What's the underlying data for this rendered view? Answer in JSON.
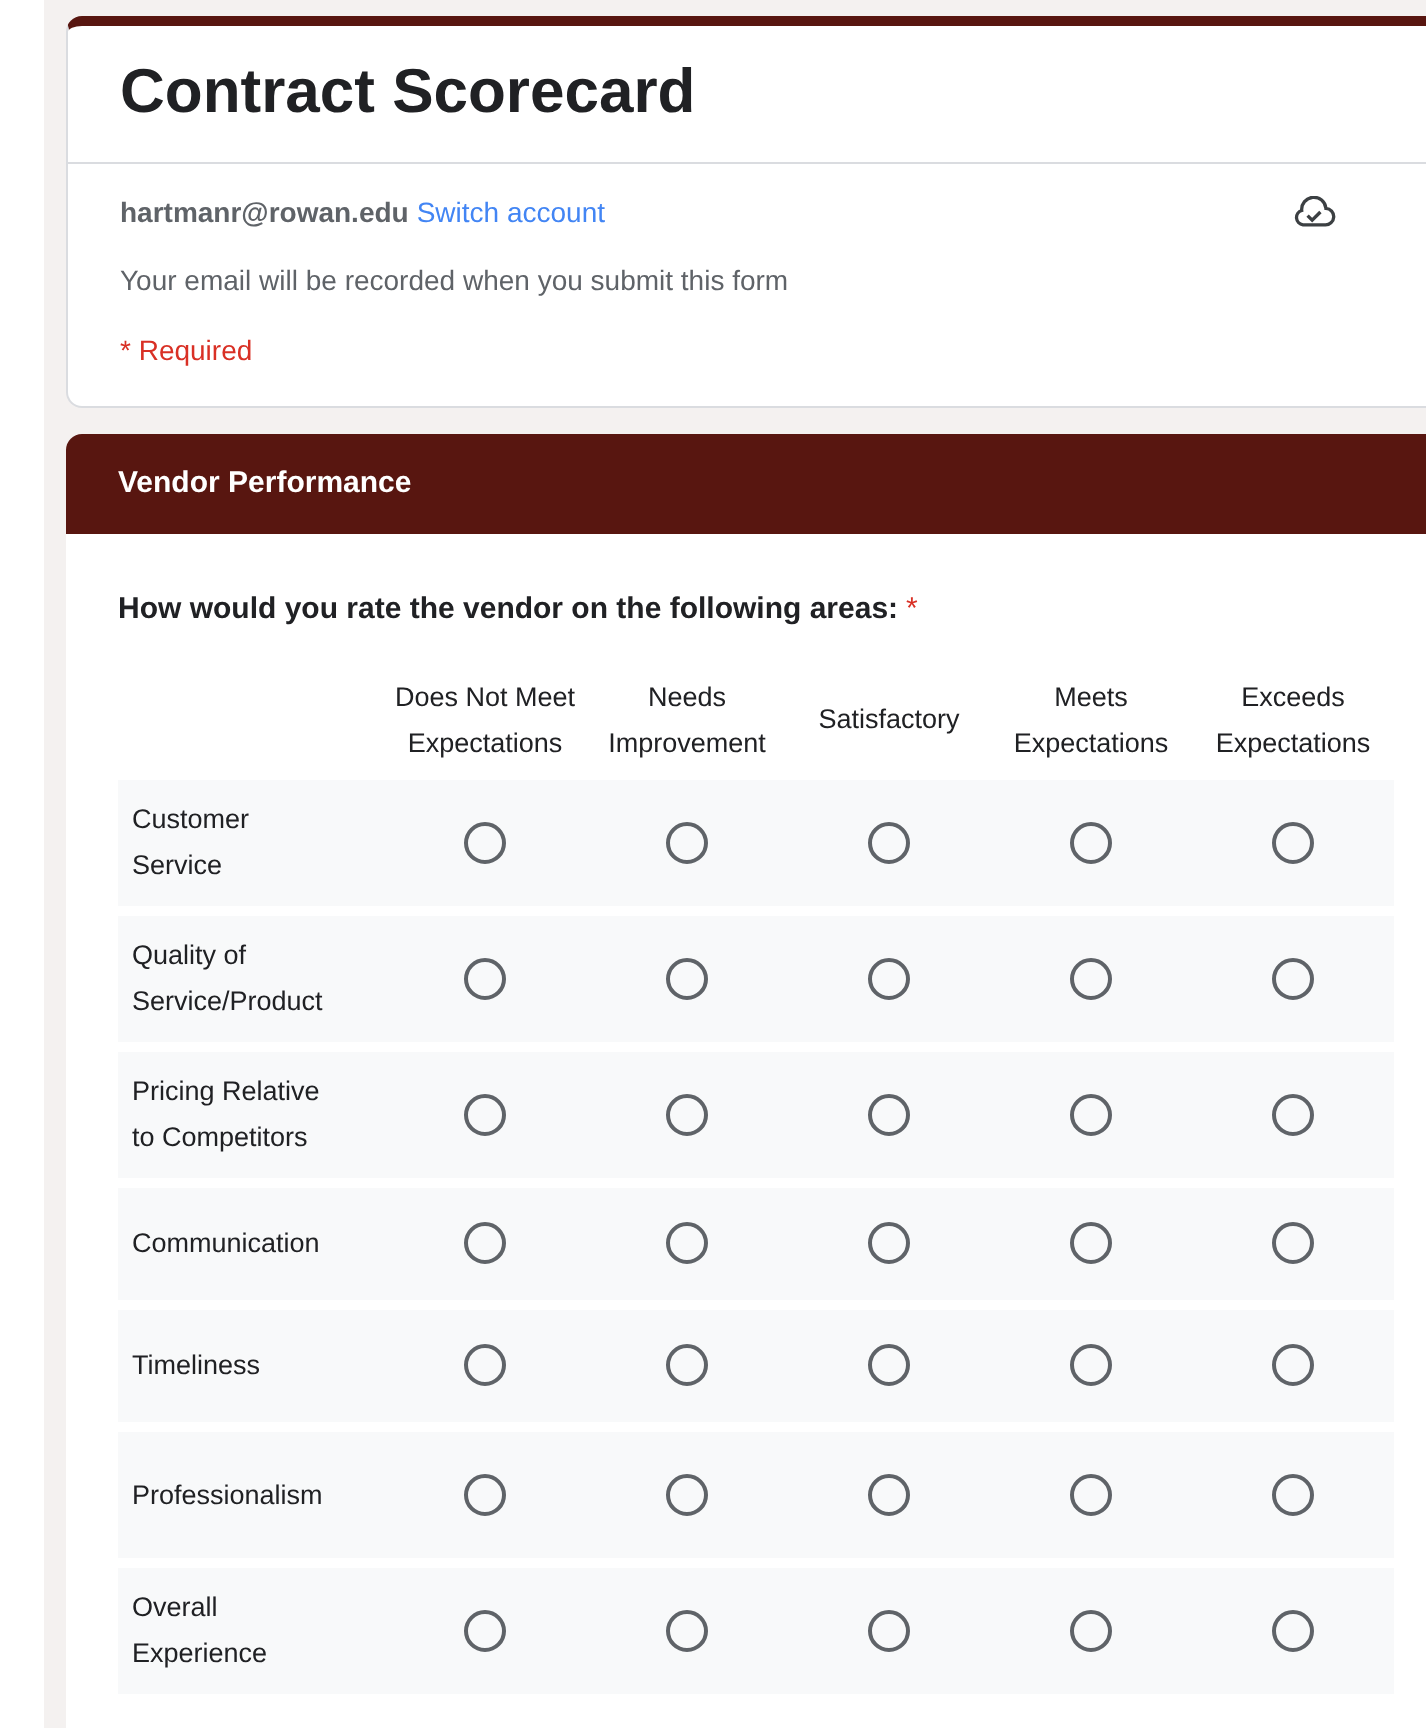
{
  "form": {
    "title": "Contract Scorecard",
    "email": "hartmanr@rowan.edu",
    "switch_account": "Switch account",
    "email_notice": "Your email will be recorded when you submit this form",
    "required_note": "* Required"
  },
  "section": {
    "title": "Vendor Performance",
    "question": "How would you rate the vendor on the following areas:",
    "required_mark": "*",
    "columns": [
      "Does Not Meet Expectations",
      "Needs Improvement",
      "Satisfactory",
      "Meets Expectations",
      "Exceeds Expectations"
    ],
    "rows": [
      {
        "label": "Customer Service",
        "options": [
          {
            "selected": false
          },
          {
            "selected": false
          },
          {
            "selected": false
          },
          {
            "selected": false
          },
          {
            "selected": false
          }
        ]
      },
      {
        "label": "Quality of Service/Product",
        "options": [
          {
            "selected": false
          },
          {
            "selected": false
          },
          {
            "selected": false
          },
          {
            "selected": false
          },
          {
            "selected": false
          }
        ]
      },
      {
        "label": "Pricing Relative to Competitors",
        "options": [
          {
            "selected": false
          },
          {
            "selected": false
          },
          {
            "selected": false
          },
          {
            "selected": false
          },
          {
            "selected": false
          }
        ]
      },
      {
        "label": "Communication",
        "options": [
          {
            "selected": false
          },
          {
            "selected": false
          },
          {
            "selected": false
          },
          {
            "selected": false
          },
          {
            "selected": false
          }
        ]
      },
      {
        "label": "Timeliness",
        "options": [
          {
            "selected": false
          },
          {
            "selected": false
          },
          {
            "selected": false
          },
          {
            "selected": false
          },
          {
            "selected": false
          }
        ]
      },
      {
        "label": "Professionalism",
        "options": [
          {
            "selected": false
          },
          {
            "selected": false
          },
          {
            "selected": false
          },
          {
            "selected": false
          },
          {
            "selected": false
          }
        ]
      },
      {
        "label": "Overall Experience",
        "options": [
          {
            "selected": false
          },
          {
            "selected": false
          },
          {
            "selected": false
          },
          {
            "selected": false
          },
          {
            "selected": false
          }
        ]
      }
    ]
  }
}
